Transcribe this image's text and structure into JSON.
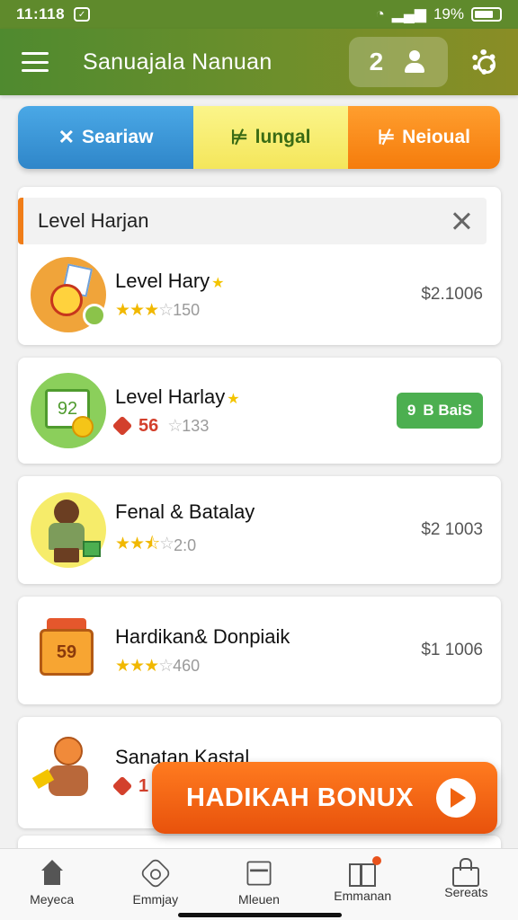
{
  "status_bar": {
    "time": "11:118",
    "battery": "19%"
  },
  "header": {
    "title": "Sanuajala Nanuan",
    "user_count": "2"
  },
  "tabs": [
    {
      "label": "Seariaw",
      "glyph": "✕"
    },
    {
      "label": "lungal",
      "glyph": "⊭"
    },
    {
      "label": "Neioual",
      "glyph": "⊭"
    }
  ],
  "section": {
    "title": "Level Harjan"
  },
  "items": [
    {
      "name": "Level Hary",
      "rating_count": "150",
      "price": "$2.1006",
      "stars": 3
    },
    {
      "name": "Level Harlay",
      "badge": "56",
      "rating_count": "133",
      "button_num": "9",
      "button_label": "B BaiS"
    },
    {
      "name": "Fenal & Batalay",
      "rating_count": "2:0",
      "price": "$2 1003",
      "stars": 2.5
    },
    {
      "name": "Hardikan& Donpiaik",
      "rating_count": "460",
      "price": "$1 1006",
      "stars": 3
    },
    {
      "name": "Sanatan Kastal",
      "badge": "1"
    }
  ],
  "thumb_text": {
    "board": "92",
    "case": "59"
  },
  "cta": {
    "label": "HADIKAH BONUX"
  },
  "bottom_nav": [
    {
      "label": "Meyeca",
      "icon": "home-icon"
    },
    {
      "label": "Emmjay",
      "icon": "puzzle-icon"
    },
    {
      "label": "Mleuen",
      "icon": "cube-icon"
    },
    {
      "label": "Emmanan",
      "icon": "gift-icon"
    },
    {
      "label": "Sereats",
      "icon": "bag-icon"
    }
  ],
  "colors": {
    "header_start": "#4f8a2f",
    "accent_orange": "#f07d18",
    "tab_blue": "#2f86c9",
    "tab_yellow": "#f4e65b",
    "green_button": "#4caf50"
  }
}
